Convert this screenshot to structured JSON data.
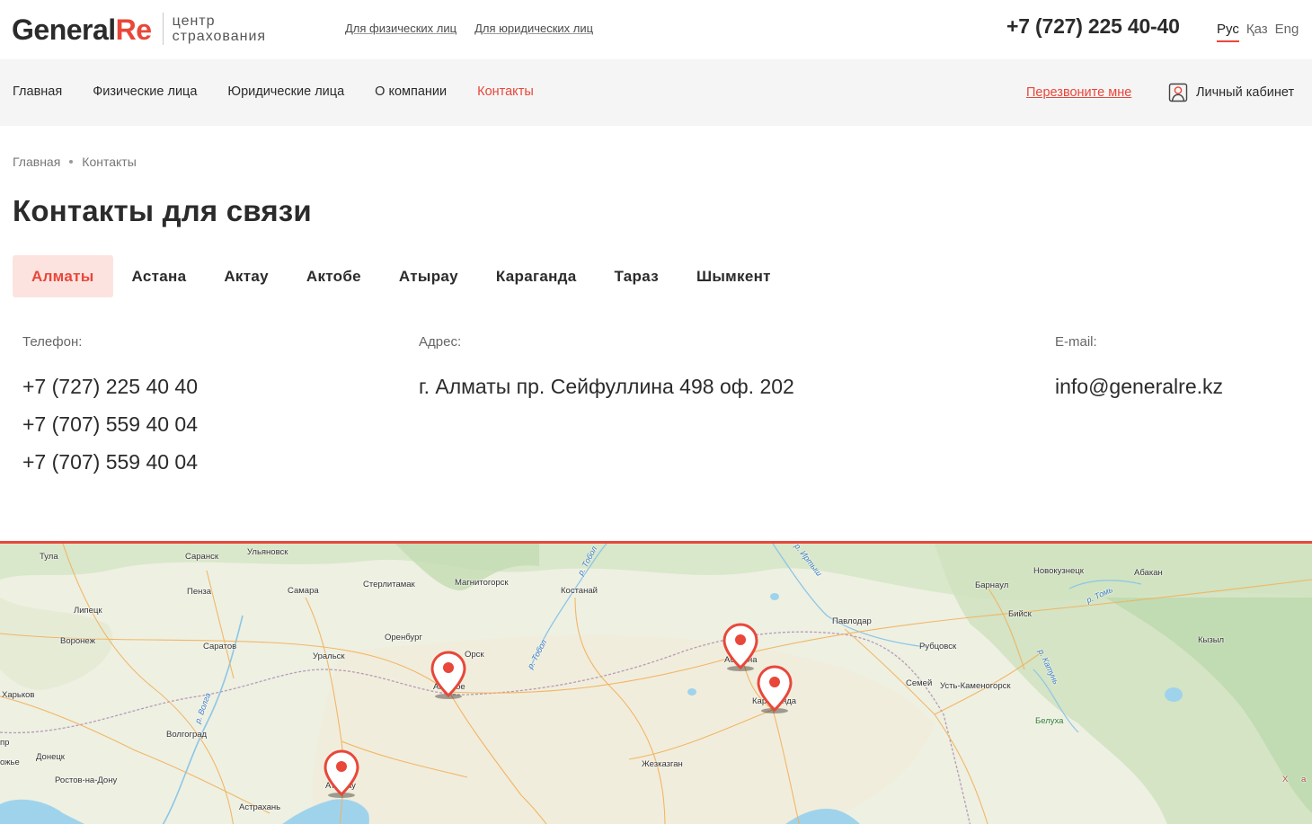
{
  "header": {
    "logo_main": "General",
    "logo_accent": "Re",
    "logo_sub_line1": "центр",
    "logo_sub_line2": "страхования",
    "links": [
      "Для физических лиц",
      "Для юридических лиц"
    ],
    "phone": "+7 (727) 225 40-40",
    "langs": [
      "Рус",
      "Қаз",
      "Eng"
    ],
    "active_lang": "Рус"
  },
  "nav": {
    "items": [
      "Главная",
      "Физические лица",
      "Юридические лица",
      "О компании",
      "Контакты"
    ],
    "active": "Контакты",
    "callback": "Перезвоните мне",
    "cabinet": "Личный кабинет"
  },
  "breadcrumb": [
    "Главная",
    "Контакты"
  ],
  "page_title": "Контакты для связи",
  "tabs": [
    "Алматы",
    "Астана",
    "Актау",
    "Актобе",
    "Атырау",
    "Караганда",
    "Тараз",
    "Шымкент"
  ],
  "active_tab": "Алматы",
  "contacts": {
    "phone_label": "Телефон:",
    "phones": [
      "+7 (727) 225 40 40",
      "+7 (707) 559 40 04",
      "+7 (707) 559 40 04"
    ],
    "address_label": "Адрес:",
    "address": "г. Алматы пр. Сейфуллина 498 оф. 202",
    "email_label": "E-mail:",
    "email": "info@generalre.kz"
  },
  "map": {
    "labels": [
      "Тула",
      "Саранск",
      "Ульяновск",
      "Пенза",
      "Самара",
      "Стерлитамак",
      "Магнитогорск",
      "Костанай",
      "Новокузнецк",
      "Абакан",
      "Барнаул",
      "Липецк",
      "Павлодар",
      "Бийск",
      "Воронеж",
      "Саратов",
      "Оренбург",
      "Орск",
      "Рубцовск",
      "Кызыл",
      "Уральск",
      "Харьков",
      "Семей",
      "Усть-Каменогорск",
      "Волгоград",
      "Белуха",
      "Донецк",
      "Ростов-на-Дону",
      "Жезказган",
      "Астрахань",
      "р. Тобол",
      "р. Иртыш",
      "р. Тобол",
      "р. Волга",
      "р. Томь",
      "р. Катунь",
      "Ак",
      "бе",
      "Ас",
      "на",
      "Кар",
      "нда",
      "Ат",
      "ау",
      "пр",
      "ожье",
      "Х",
      "а"
    ],
    "pin_colors": {
      "pin": "#e8473a",
      "water": "#9fd3ec"
    }
  }
}
